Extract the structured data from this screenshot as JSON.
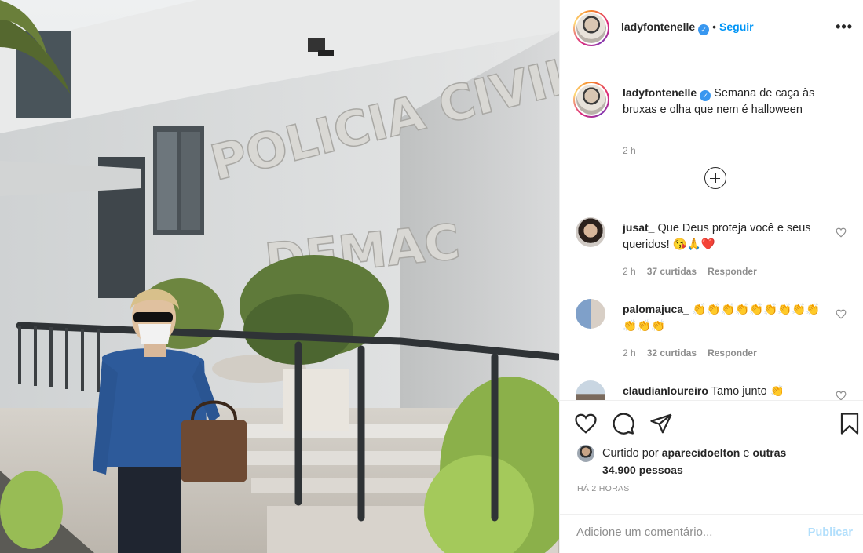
{
  "post": {
    "username": "ladyfontenelle",
    "verified_icon": "verified-badge-icon",
    "follow_label": "Seguir",
    "more_label": "•••",
    "photo_sign": {
      "line1": "POLICIA CIVIL",
      "line2": "DEMAC"
    }
  },
  "caption": {
    "username": "ladyfontenelle",
    "text": "Semana de caça às bruxas e olha que nem é halloween",
    "time": "2 h"
  },
  "comments": [
    {
      "username": "jusat_",
      "text": "Que Deus proteja você e seus queridos! 😘🙏❤️",
      "time": "2 h",
      "likes": "37 curtidas",
      "reply": "Responder"
    },
    {
      "username": "palomajuca_",
      "text": "👏👏👏👏👏👏👏👏👏👏👏👏",
      "time": "2 h",
      "likes": "32 curtidas",
      "reply": "Responder"
    },
    {
      "username": "claudianloureiro",
      "text": "Tamo junto 👏",
      "time": "",
      "likes": "",
      "reply": ""
    }
  ],
  "actions": {
    "icons": [
      "heart-icon",
      "comment-icon",
      "share-icon",
      "bookmark-icon"
    ],
    "liked_by_prefix": "Curtido por",
    "liked_by_user": "aparecidoelton",
    "liked_by_suffix": "e",
    "liked_by_others": "outras 34.900 pessoas",
    "ago": "HÁ 2 HORAS"
  },
  "add_comment": {
    "placeholder": "Adicione um comentário...",
    "publish_label": "Publicar"
  },
  "colors": {
    "accent": "#0095f6",
    "publish_disabled": "#b2dffc",
    "muted": "#8e8e8e"
  }
}
